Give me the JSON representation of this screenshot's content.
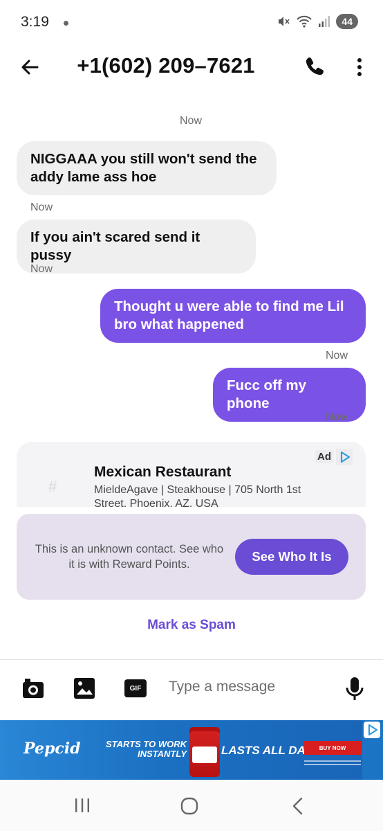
{
  "status_bar": {
    "time": "3:19",
    "battery": "44"
  },
  "header": {
    "contact": "+1(602) 209–7621"
  },
  "messages": [
    {
      "direction": "system",
      "timestamp": "Now"
    },
    {
      "direction": "incoming",
      "text": "NIGGAAA you still won't send the addy lame ass hoe",
      "timestamp": "Now"
    },
    {
      "direction": "incoming",
      "text": "If you ain't scared send it pussy",
      "timestamp": "Now"
    },
    {
      "direction": "outgoing",
      "text": "Thought u were able to find me Lil bro what happened",
      "timestamp": "Now"
    },
    {
      "direction": "outgoing",
      "text": "Fucc off my phone",
      "timestamp": "Now"
    }
  ],
  "ad_card": {
    "badge": "Ad",
    "placeholder_glyph": "#",
    "title": "Mexican Restaurant",
    "description": "MieldeAgave | Steakhouse | 705 North 1st Street, Phoenix, AZ, USA"
  },
  "unknown_contact": {
    "text": "This is an unknown contact. See who it is with Reward Points.",
    "button": "See Who It Is"
  },
  "spam": {
    "label": "Mark as Spam"
  },
  "composer": {
    "placeholder": "Type a message",
    "gif_label": "GIF"
  },
  "banner_ad": {
    "brand": "Pepcid",
    "tagline_1": "STARTS TO WORK",
    "tagline_2": "INSTANTLY",
    "tagline_3": "LASTS ALL DAY°",
    "cta": "BUY NOW"
  },
  "colors": {
    "accent": "#7b52e6",
    "button": "#6a4dd4",
    "incoming_bubble": "#efefef",
    "panel": "#e6e0ee"
  }
}
